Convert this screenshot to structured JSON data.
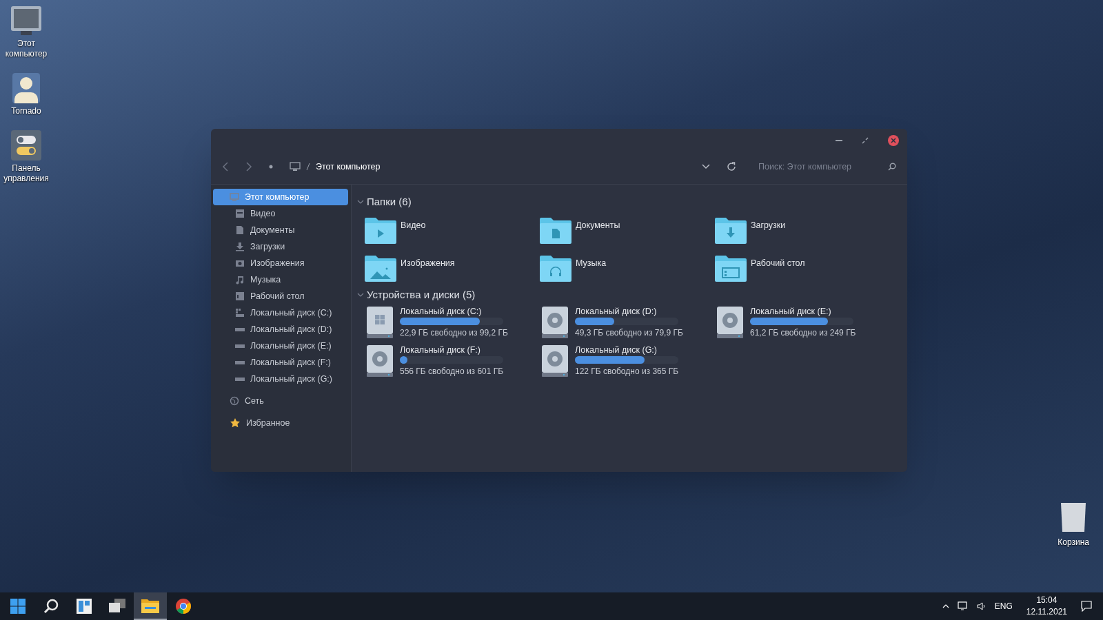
{
  "desktop_icons": [
    {
      "kind": "computer",
      "label": "Этот компьютер"
    },
    {
      "kind": "user",
      "label": "Tornado"
    },
    {
      "kind": "control-panel",
      "label": "Панель управления"
    }
  ],
  "recycle_bin": {
    "label": "Корзина"
  },
  "window": {
    "address": {
      "path": "Этот компьютер"
    },
    "search": {
      "placeholder": "Поиск: Этот компьютер"
    },
    "sidebar": {
      "items": [
        {
          "kind": "computer",
          "label": "Этот компьютер",
          "selected": true,
          "children": [
            {
              "kind": "video",
              "label": "Видео",
              "selected": false
            },
            {
              "kind": "documents",
              "label": "Документы",
              "selected": false
            },
            {
              "kind": "downloads",
              "label": "Загрузки",
              "selected": false
            },
            {
              "kind": "pictures",
              "label": "Изображения",
              "selected": false
            },
            {
              "kind": "music",
              "label": "Музыка",
              "selected": false
            },
            {
              "kind": "desktop",
              "label": "Рабочий стол",
              "selected": false
            },
            {
              "kind": "system-drive",
              "label": "Локальный диск (C:)",
              "selected": false
            },
            {
              "kind": "drive",
              "label": "Локальный диск (D:)",
              "selected": false
            },
            {
              "kind": "drive",
              "label": "Локальный диск (E:)",
              "selected": false
            },
            {
              "kind": "drive",
              "label": "Локальный диск (F:)",
              "selected": false
            },
            {
              "kind": "drive",
              "label": "Локальный диск (G:)",
              "selected": false
            }
          ]
        },
        {
          "kind": "network",
          "label": "Сеть",
          "selected": false
        },
        {
          "kind": "favorites",
          "label": "Избранное",
          "selected": false
        }
      ]
    },
    "folders": {
      "title": "Папки (6)",
      "expanded": true,
      "items": [
        {
          "kind": "video",
          "label": "Видео"
        },
        {
          "kind": "documents",
          "label": "Документы"
        },
        {
          "kind": "downloads",
          "label": "Загрузки"
        },
        {
          "kind": "pictures",
          "label": "Изображения"
        },
        {
          "kind": "music",
          "label": "Музыка"
        },
        {
          "kind": "desktop",
          "label": "Рабочий стол"
        }
      ]
    },
    "drives": {
      "title": "Устройства и диски (5)",
      "expanded": true,
      "items": [
        {
          "kind": "system",
          "label": "Локальный диск (C:)",
          "level": 0.77,
          "info": "22,9 ГБ свободно из 99,2 ГБ"
        },
        {
          "kind": "disk",
          "label": "Локальный диск (D:)",
          "level": 0.38,
          "info": "49,3 ГБ свободно из 79,9 ГБ"
        },
        {
          "kind": "disk",
          "label": "Локальный диск (E:)",
          "level": 0.75,
          "info": "61,2 ГБ свободно из 249 ГБ"
        },
        {
          "kind": "disk",
          "label": "Локальный диск (F:)",
          "level": 0.075,
          "info": "556 ГБ свободно из 601 ГБ"
        },
        {
          "kind": "disk",
          "label": "Локальный диск (G:)",
          "level": 0.67,
          "info": "122 ГБ свободно из 365 ГБ"
        }
      ]
    }
  },
  "taskbar": {
    "apps": [
      {
        "kind": "start",
        "active": false
      },
      {
        "kind": "search",
        "active": false
      },
      {
        "kind": "widgets",
        "active": false
      },
      {
        "kind": "task-view",
        "active": false
      },
      {
        "kind": "explorer",
        "active": true
      },
      {
        "kind": "browser",
        "active": false
      }
    ],
    "language": "ENG",
    "time": "15:04",
    "date": "12.11.2021"
  }
}
